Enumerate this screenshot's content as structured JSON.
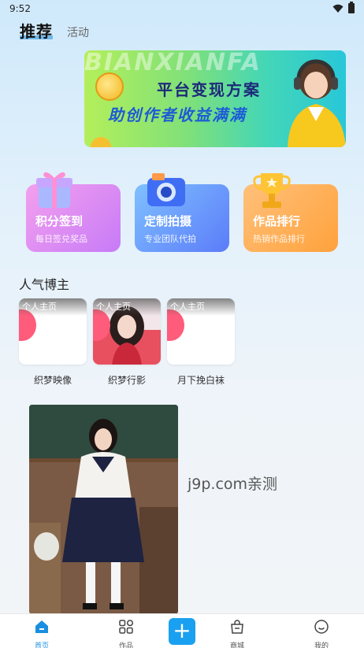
{
  "status_bar": {
    "time": "9:52"
  },
  "top_tabs": [
    {
      "label": "推荐",
      "active": true
    },
    {
      "label": "活动",
      "active": false
    }
  ],
  "banner": {
    "watermark": "BIANXIANFA",
    "line1": "平台变现方案",
    "line2": "助创作者收益满满"
  },
  "quick_cards": [
    {
      "title": "积分签到",
      "subtitle": "每日签兑奖品",
      "icon": "gift-box-icon"
    },
    {
      "title": "定制拍摄",
      "subtitle": "专业团队代拍",
      "icon": "camera-icon"
    },
    {
      "title": "作品排行",
      "subtitle": "热销作品排行",
      "icon": "trophy-icon"
    }
  ],
  "popular_section": {
    "title": "人气博主"
  },
  "bloggers": [
    {
      "tag": "个人主页",
      "name": "织梦映像"
    },
    {
      "tag": "个人主页",
      "name": "织梦行影"
    },
    {
      "tag": "个人主页",
      "name": "月下挽白袜"
    }
  ],
  "watermark_text": "j9p.com亲测",
  "bottom_nav": [
    {
      "label": "首页",
      "icon": "home-icon",
      "active": true
    },
    {
      "label": "作品",
      "icon": "grid-icon",
      "active": false
    },
    {
      "label": "",
      "icon": "plus-icon",
      "active": false
    },
    {
      "label": "商城",
      "icon": "shop-bag-icon",
      "active": false
    },
    {
      "label": "我的",
      "icon": "profile-icon",
      "active": false
    }
  ],
  "colors": {
    "accent": "#1aa0f0",
    "pink_card": "#d98af5",
    "blue_card": "#6d9bfb",
    "orange_card": "#ffb052"
  }
}
